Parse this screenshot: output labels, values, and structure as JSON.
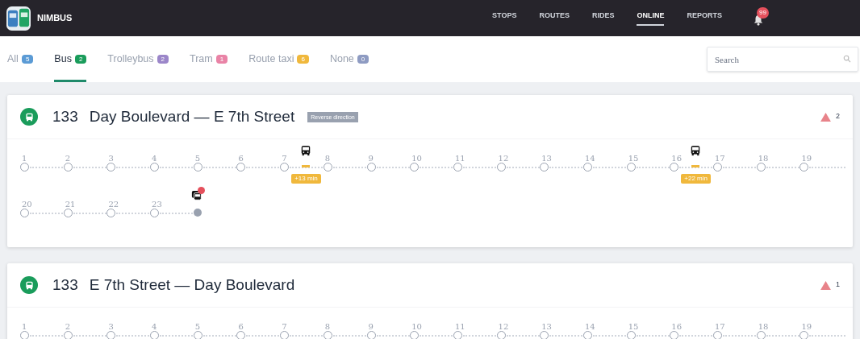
{
  "app": {
    "name": "NIMBUS"
  },
  "nav": [
    {
      "label": "STOPS",
      "selected": false
    },
    {
      "label": "ROUTES",
      "selected": false
    },
    {
      "label": "RIDES",
      "selected": false
    },
    {
      "label": "ONLINE",
      "selected": true
    },
    {
      "label": "REPORTS",
      "selected": false
    }
  ],
  "notifications": {
    "count": "99"
  },
  "tabs": [
    {
      "label": "All",
      "count": "5",
      "color": "#5b9bd5",
      "selected": false
    },
    {
      "label": "Bus",
      "count": "2",
      "color": "#1a9c5b",
      "selected": true
    },
    {
      "label": "Trolleybus",
      "count": "2",
      "color": "#9b86c9",
      "selected": false
    },
    {
      "label": "Tram",
      "count": "1",
      "color": "#e983a6",
      "selected": false
    },
    {
      "label": "Route taxi",
      "count": "6",
      "color": "#f0b83c",
      "selected": false
    },
    {
      "label": "None",
      "count": "0",
      "color": "#8e9bc2",
      "selected": false
    }
  ],
  "search": {
    "placeholder": "Search"
  },
  "routes": [
    {
      "number": "133",
      "name": "Day Boulevard — E 7th Street",
      "tag": "Reverse direction",
      "alerts": "2",
      "stops": [
        {
          "kind": "stop",
          "label": "1"
        },
        {
          "kind": "stop",
          "label": "2"
        },
        {
          "kind": "stop",
          "label": "3"
        },
        {
          "kind": "stop",
          "label": "4"
        },
        {
          "kind": "stop",
          "label": "5"
        },
        {
          "kind": "stop",
          "label": "6"
        },
        {
          "kind": "stop",
          "label": "7",
          "vehicle_after": {
            "delay": "+13 min"
          }
        },
        {
          "kind": "stop",
          "label": "8"
        },
        {
          "kind": "stop",
          "label": "9"
        },
        {
          "kind": "stop",
          "label": "10"
        },
        {
          "kind": "stop",
          "label": "11"
        },
        {
          "kind": "stop",
          "label": "12"
        },
        {
          "kind": "stop",
          "label": "13"
        },
        {
          "kind": "stop",
          "label": "14"
        },
        {
          "kind": "stop",
          "label": "15"
        },
        {
          "kind": "stop",
          "label": "16",
          "vehicle_after": {
            "delay": "+22 min"
          }
        },
        {
          "kind": "stop",
          "label": "17"
        },
        {
          "kind": "stop",
          "label": "18"
        },
        {
          "kind": "stop",
          "label": "19"
        },
        {
          "kind": "stop",
          "label": "20"
        },
        {
          "kind": "stop",
          "label": "21"
        },
        {
          "kind": "stop",
          "label": "22"
        },
        {
          "kind": "stop",
          "label": "23"
        },
        {
          "kind": "depot",
          "alert": true
        }
      ]
    },
    {
      "number": "133",
      "name": "E 7th Street — Day Boulevard",
      "alerts": "1",
      "stops": [
        {
          "kind": "stop",
          "label": "1"
        },
        {
          "kind": "stop",
          "label": "2"
        },
        {
          "kind": "stop",
          "label": "3"
        },
        {
          "kind": "stop",
          "label": "4"
        },
        {
          "kind": "stop",
          "label": "5"
        },
        {
          "kind": "stop",
          "label": "6"
        },
        {
          "kind": "stop",
          "label": "7"
        },
        {
          "kind": "stop",
          "label": "8"
        },
        {
          "kind": "stop",
          "label": "9"
        },
        {
          "kind": "stop",
          "label": "10"
        },
        {
          "kind": "stop",
          "label": "11"
        },
        {
          "kind": "stop",
          "label": "12"
        },
        {
          "kind": "stop",
          "label": "13"
        },
        {
          "kind": "stop",
          "label": "14"
        },
        {
          "kind": "stop",
          "label": "15"
        },
        {
          "kind": "stop",
          "label": "16"
        },
        {
          "kind": "stop",
          "label": "17"
        },
        {
          "kind": "stop",
          "label": "18"
        },
        {
          "kind": "stop",
          "label": "19"
        }
      ]
    }
  ]
}
